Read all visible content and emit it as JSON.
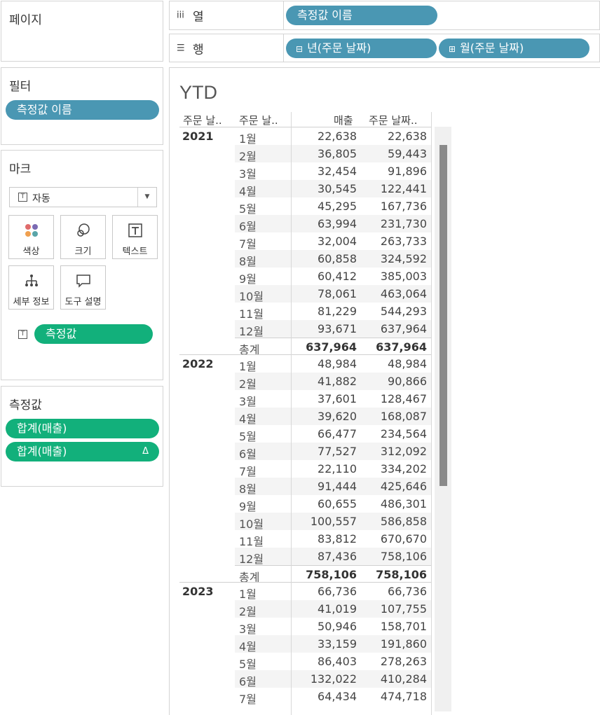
{
  "pages_panel": {
    "title": "페이지"
  },
  "columns_shelf": {
    "label": "열",
    "icon": "columns-icon",
    "pills": [
      "측정값 이름"
    ]
  },
  "rows_shelf": {
    "label": "행",
    "icon": "rows-icon",
    "pills": [
      "년(주문 날짜)",
      "월(주문 날짜)"
    ]
  },
  "filters_panel": {
    "title": "필터",
    "pills": [
      "측정값 이름"
    ]
  },
  "marks_panel": {
    "title": "마크",
    "mark_type": "자동",
    "buttons": [
      "색상",
      "크기",
      "텍스트",
      "세부 정보",
      "도구 설명"
    ],
    "text_pill": "측정값"
  },
  "measures_panel": {
    "title": "측정값",
    "pills": [
      "합계(매출)",
      "합계(매출)"
    ],
    "delta_symbol": "Δ"
  },
  "sheet": {
    "title": "YTD",
    "headers": [
      "주문 날..",
      "주문 날..",
      "매출",
      "주문 날짜.."
    ],
    "years": [
      {
        "year": "2021",
        "months": [
          [
            "1월",
            "22,638",
            "22,638"
          ],
          [
            "2월",
            "36,805",
            "59,443"
          ],
          [
            "3월",
            "32,454",
            "91,896"
          ],
          [
            "4월",
            "30,545",
            "122,441"
          ],
          [
            "5월",
            "45,295",
            "167,736"
          ],
          [
            "6월",
            "63,994",
            "231,730"
          ],
          [
            "7월",
            "32,004",
            "263,733"
          ],
          [
            "8월",
            "60,858",
            "324,592"
          ],
          [
            "9월",
            "60,412",
            "385,003"
          ],
          [
            "10월",
            "78,061",
            "463,064"
          ],
          [
            "11월",
            "81,229",
            "544,293"
          ],
          [
            "12월",
            "93,671",
            "637,964"
          ]
        ],
        "total": [
          "총계",
          "637,964",
          "637,964"
        ]
      },
      {
        "year": "2022",
        "months": [
          [
            "1월",
            "48,984",
            "48,984"
          ],
          [
            "2월",
            "41,882",
            "90,866"
          ],
          [
            "3월",
            "37,601",
            "128,467"
          ],
          [
            "4월",
            "39,620",
            "168,087"
          ],
          [
            "5월",
            "66,477",
            "234,564"
          ],
          [
            "6월",
            "77,527",
            "312,092"
          ],
          [
            "7월",
            "22,110",
            "334,202"
          ],
          [
            "8월",
            "91,444",
            "425,646"
          ],
          [
            "9월",
            "60,655",
            "486,301"
          ],
          [
            "10월",
            "100,557",
            "586,858"
          ],
          [
            "11월",
            "83,812",
            "670,670"
          ],
          [
            "12월",
            "87,436",
            "758,106"
          ]
        ],
        "total": [
          "총계",
          "758,106",
          "758,106"
        ]
      },
      {
        "year": "2023",
        "months": [
          [
            "1월",
            "66,736",
            "66,736"
          ],
          [
            "2월",
            "41,019",
            "107,755"
          ],
          [
            "3월",
            "50,946",
            "158,701"
          ],
          [
            "4월",
            "33,159",
            "191,860"
          ],
          [
            "5월",
            "86,403",
            "278,263"
          ],
          [
            "6월",
            "132,022",
            "410,284"
          ],
          [
            "7월",
            "64,434",
            "474,718"
          ]
        ]
      }
    ]
  },
  "colors": {
    "blue_pill": "#4a97b3",
    "green_pill": "#12b07b"
  }
}
